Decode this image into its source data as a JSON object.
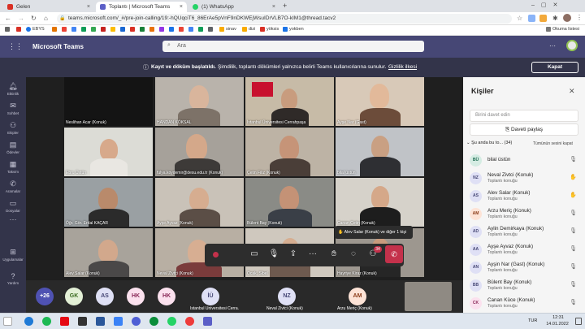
{
  "browser": {
    "tabs": [
      {
        "label": "Gelen",
        "color": "#d93025"
      },
      {
        "label": "Toplantı | Microsoft Teams",
        "color": "#5b5fc7"
      },
      {
        "label": "(1) WhatsApp",
        "color": "#25d366"
      }
    ],
    "url": "teams.microsoft.com/_#/pre-join-calling/19:-hQUqciT6_86ErAe5pVnF9nDKWEjWsuIDrVLB7O-kIM1@thread.tacv2",
    "bookmarks": [
      "EBYS",
      "sinav",
      "dizi",
      "yöksis",
      "yokben"
    ],
    "reading_list": "Okuma listesi"
  },
  "teams": {
    "app_title": "Microsoft Teams",
    "search_placeholder": "Ara",
    "notice_bold": "Kayıt ve döküm başlatıldı.",
    "notice_text": "Şimdilik, toplantı dökümleri yalnızca belirli Teams kullanıcılarına sunulur.",
    "notice_link": "Gizlilik ilkesi",
    "notice_close": "Kapat",
    "rail": [
      "Etkinlik",
      "Sohbet",
      "Ekipler",
      "Ödevler",
      "Takvim",
      "Aramalar",
      "Dosyalar",
      "Uygulamalar",
      "Yardım"
    ]
  },
  "tiles": [
    {
      "name": "Neslihan Acar (Konuk)"
    },
    {
      "name": "HANDAN KÖKSAL"
    },
    {
      "name": "İstanbul Üniversitesi Cerrahpaşa"
    },
    {
      "name": "Ayşe Nar (Gast)"
    },
    {
      "name": "Ebru Üstün"
    },
    {
      "name": "fulya.koydemir@desu.edu.tr (Konuk)"
    },
    {
      "name": "Çetin Filiz (Konuk)"
    },
    {
      "name": "bilal üstün"
    },
    {
      "name": "Öğr. Gör. Erdal KAÇAR"
    },
    {
      "name": "Ayşe Ayvaz (Konuk)"
    },
    {
      "name": "Bülent Bay (Konuk)"
    },
    {
      "name": "Canan Çetin (Konuk)"
    },
    {
      "name": "Alev Salar (Konuk)"
    },
    {
      "name": "Neval Zivtci (Konuk)"
    },
    {
      "name": "Ocak, Sibel"
    },
    {
      "name": "Hayriye Kiraz (Konuk)"
    }
  ],
  "toast": "Alev Salar (Konuk) ve diğer 1 kişi",
  "controls": [
    "video-icon",
    "mic-off-icon",
    "share-icon",
    "more-icon",
    "raise-hand-icon",
    "chat-icon",
    "participants-icon"
  ],
  "participants_badge": "34",
  "roster": [
    {
      "initials": "+26",
      "bg": "#4f52b2",
      "fg": "#ffffff"
    },
    {
      "initials": "GK",
      "bg": "#e3f0d6",
      "fg": "#3a6b1f"
    },
    {
      "initials": "AS",
      "bg": "#dfe0f5",
      "fg": "#464775"
    },
    {
      "initials": "HK",
      "bg": "#fbe1ee",
      "fg": "#8b2b59"
    },
    {
      "initials": "HK",
      "bg": "#fbe1ee",
      "fg": "#8b2b59"
    },
    {
      "initials": "İÜ",
      "bg": "#dfe0f5",
      "fg": "#464775",
      "label": "İstanbul Üniversitesi Cerra..."
    },
    {
      "initials": "NZ",
      "bg": "#dfe0f5",
      "fg": "#464775",
      "label": "Neval Zivtci (Konuk)"
    },
    {
      "initials": "AM",
      "bg": "#fde3d6",
      "fg": "#8a3b18",
      "label": "Arzu Meriç (Konuk)"
    }
  ],
  "people": {
    "title": "Kişiler",
    "invite_placeholder": "Birini davet edin",
    "share_invite": "Daveti paylaş",
    "section": "Şu anda bu to...",
    "count": "(34)",
    "mute_all": "Tümünün sesini kapat",
    "members": [
      {
        "initials": "BÜ",
        "name": "bilal üstün",
        "role": "",
        "bg": "#d5ece3",
        "fg": "#1e6b52",
        "hand": false
      },
      {
        "initials": "NZ",
        "name": "Neval Zivtci (Konuk)",
        "role": "Toplantı konuğu",
        "bg": "#dfe0f5",
        "fg": "#464775",
        "hand": true
      },
      {
        "initials": "AS",
        "name": "Alev Salar (Konuk)",
        "role": "Toplantı konuğu",
        "bg": "#dfe0f5",
        "fg": "#464775",
        "hand": true
      },
      {
        "initials": "AM",
        "name": "Arzu Meriç (Konuk)",
        "role": "Toplantı konuğu",
        "bg": "#fde3d6",
        "fg": "#8a3b18",
        "hand": false
      },
      {
        "initials": "AD",
        "name": "Aylin Demirkaya (Konuk)",
        "role": "Toplantı konuğu",
        "bg": "#dfe0f5",
        "fg": "#464775",
        "hand": false
      },
      {
        "initials": "AA",
        "name": "Ayşe Ayvaz (Konuk)",
        "role": "Toplantı konuğu",
        "bg": "#dfe0f5",
        "fg": "#464775",
        "hand": false
      },
      {
        "initials": "AN",
        "name": "Ayşin Nar (Gast) (Konuk)",
        "role": "Toplantı konuğu",
        "bg": "#dfe0f5",
        "fg": "#464775",
        "hand": false
      },
      {
        "initials": "BB",
        "name": "Bülent Bay (Konuk)",
        "role": "Toplantı konuğu",
        "bg": "#dfe0f5",
        "fg": "#464775",
        "hand": false
      },
      {
        "initials": "CK",
        "name": "Canan Küce (Konuk)",
        "role": "Toplantı konuğu",
        "bg": "#fbe1ee",
        "fg": "#8b2b59",
        "hand": false
      }
    ]
  },
  "taskbar": {
    "lang": "TUR",
    "time": "12:31",
    "date": "14.01.2022"
  }
}
